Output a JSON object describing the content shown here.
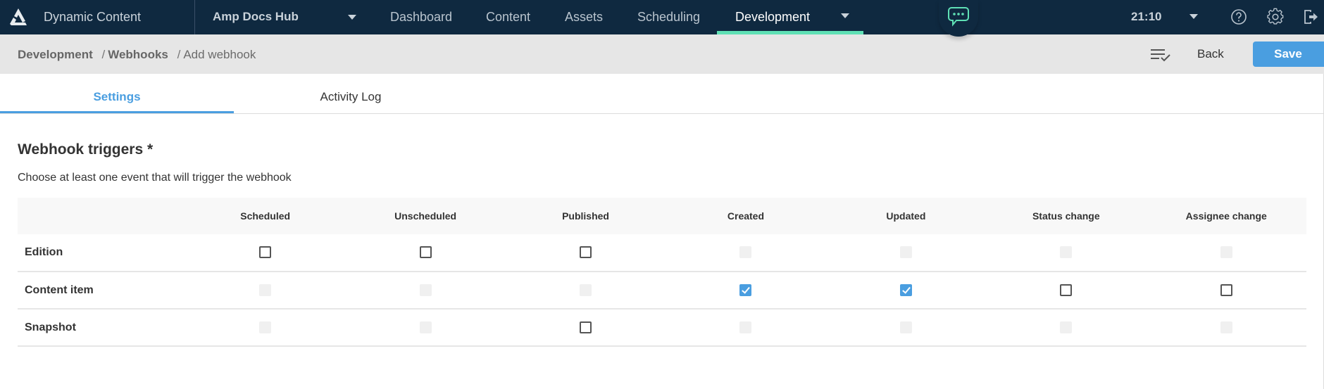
{
  "topbar": {
    "app_title": "Dynamic Content",
    "hub_name": "Amp Docs Hub",
    "nav": [
      {
        "label": "Dashboard",
        "active": false
      },
      {
        "label": "Content",
        "active": false
      },
      {
        "label": "Assets",
        "active": false
      },
      {
        "label": "Scheduling",
        "active": false
      },
      {
        "label": "Development",
        "active": true
      }
    ],
    "clock": "21:10",
    "icons": [
      "logo-icon",
      "chat-icon",
      "help-icon",
      "settings-icon",
      "logout-icon"
    ],
    "accent_color": "#5fe0b5",
    "background_color": "#0f2940"
  },
  "breadcrumb": {
    "items": [
      "Development",
      "Webhooks",
      "Add webhook"
    ],
    "separator": "/"
  },
  "actions": {
    "back_label": "Back",
    "save_label": "Save",
    "save_color": "#4a9ee0"
  },
  "tabs": [
    {
      "label": "Settings",
      "active": true
    },
    {
      "label": "Activity Log",
      "active": false
    }
  ],
  "section": {
    "title": "Webhook triggers *",
    "description": "Choose at least one event that will trigger the webhook"
  },
  "trigger_matrix": {
    "columns": [
      "Scheduled",
      "Unscheduled",
      "Published",
      "Created",
      "Updated",
      "Status change",
      "Assignee change"
    ],
    "rows": [
      {
        "label": "Edition",
        "states": [
          "unchecked",
          "unchecked",
          "unchecked",
          "disabled",
          "disabled",
          "disabled",
          "disabled"
        ]
      },
      {
        "label": "Content item",
        "states": [
          "disabled",
          "disabled",
          "disabled",
          "checked",
          "checked",
          "unchecked",
          "unchecked"
        ]
      },
      {
        "label": "Snapshot",
        "states": [
          "disabled",
          "disabled",
          "unchecked",
          "disabled",
          "disabled",
          "disabled",
          "disabled"
        ]
      }
    ]
  }
}
